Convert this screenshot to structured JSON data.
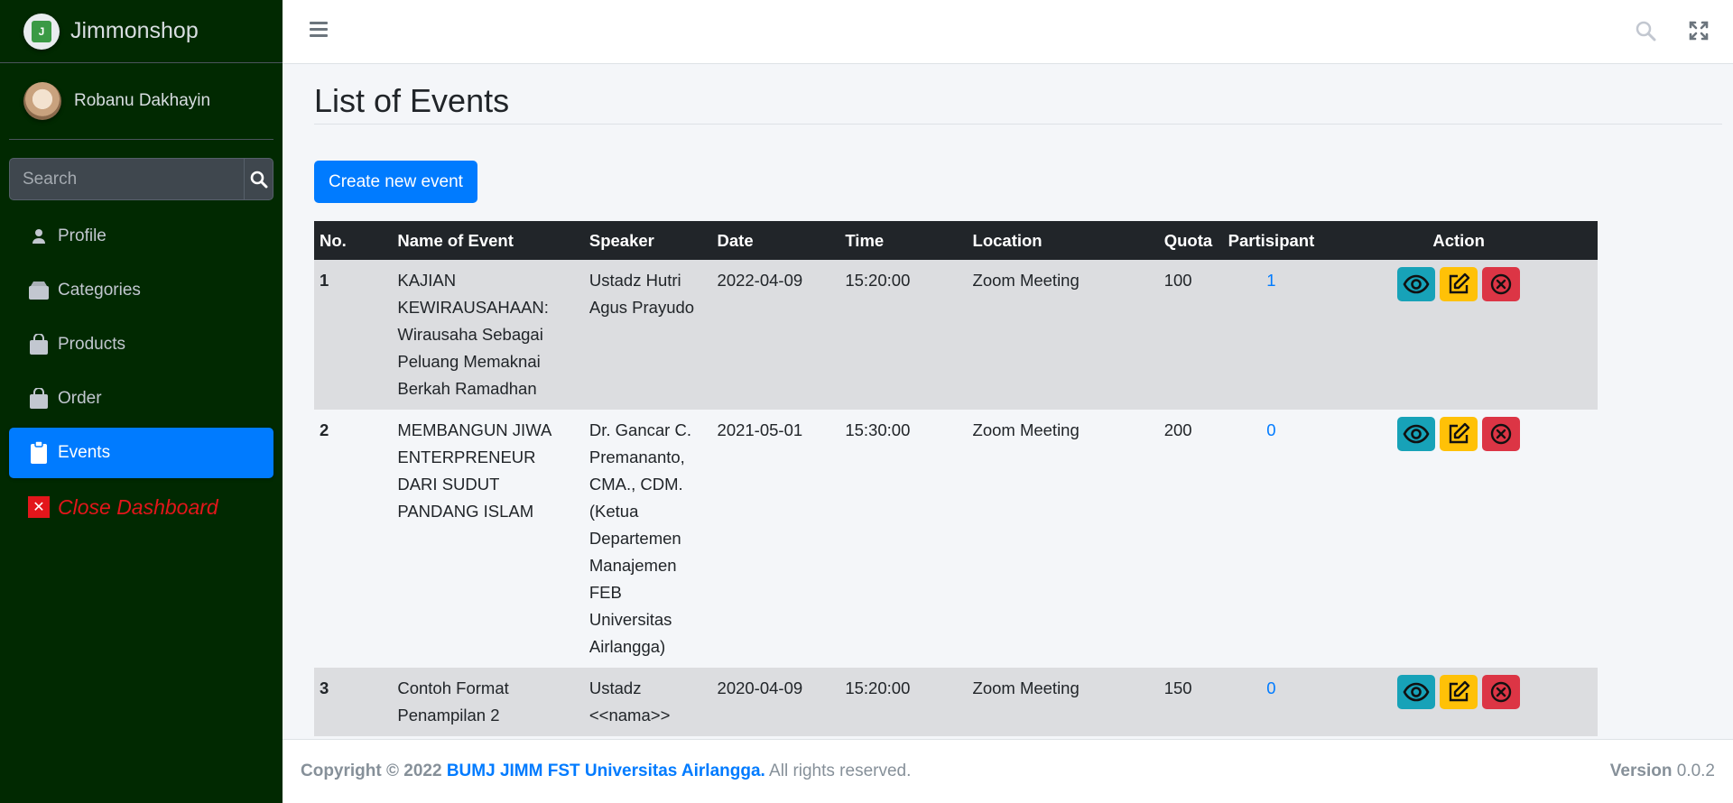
{
  "brand": {
    "name": "Jimmonshop",
    "logo_text": "J"
  },
  "user": {
    "name": "Robanu Dakhayin"
  },
  "sidebar": {
    "search_placeholder": "Search",
    "items": [
      {
        "label": "Profile",
        "icon": "person-icon"
      },
      {
        "label": "Categories",
        "icon": "box-icon"
      },
      {
        "label": "Products",
        "icon": "bag-icon"
      },
      {
        "label": "Order",
        "icon": "bag-icon"
      },
      {
        "label": "Events",
        "icon": "clipboard-icon",
        "active": true
      }
    ],
    "close_label": "Close Dashboard"
  },
  "page": {
    "title": "List of Events",
    "create_button": "Create new event"
  },
  "table": {
    "headers": [
      "No.",
      "Name of Event",
      "Speaker",
      "Date",
      "Time",
      "Location",
      "Quota",
      "Partisipant",
      "Action"
    ],
    "rows": [
      {
        "no": "1",
        "name": "KAJIAN KEWIRAUSAHAAN: Wirausaha Sebagai Peluang Memaknai Berkah Ramadhan",
        "speaker": "Ustadz Hutri Agus Prayudo",
        "date": "2022-04-09",
        "time": "15:20:00",
        "location": "Zoom Meeting",
        "quota": "100",
        "participant": "1"
      },
      {
        "no": "2",
        "name": "MEMBANGUN JIWA ENTERPRENEUR DARI SUDUT PANDANG ISLAM",
        "speaker": "Dr. Gancar C. Premananto, CMA., CDM. (Ketua Departemen Manajemen FEB Universitas Airlangga)",
        "date": "2021-05-01",
        "time": "15:30:00",
        "location": "Zoom Meeting",
        "quota": "200",
        "participant": "0"
      },
      {
        "no": "3",
        "name": "Contoh Format Penampilan 2",
        "speaker": "Ustadz <<nama>>",
        "date": "2020-04-09",
        "time": "15:20:00",
        "location": "Zoom Meeting",
        "quota": "150",
        "participant": "0"
      }
    ]
  },
  "footer": {
    "copyright_prefix": "Copyright © 2022",
    "org": "BUMJ JIMM FST Universitas Airlangga.",
    "rights": "All rights reserved.",
    "version_label": "Version",
    "version": "0.0.2"
  },
  "colors": {
    "sidebar_bg": "#012901",
    "primary": "#007bff",
    "info": "#17a2b8",
    "warning": "#ffc107",
    "danger": "#dc3545",
    "close": "#e3161b"
  }
}
